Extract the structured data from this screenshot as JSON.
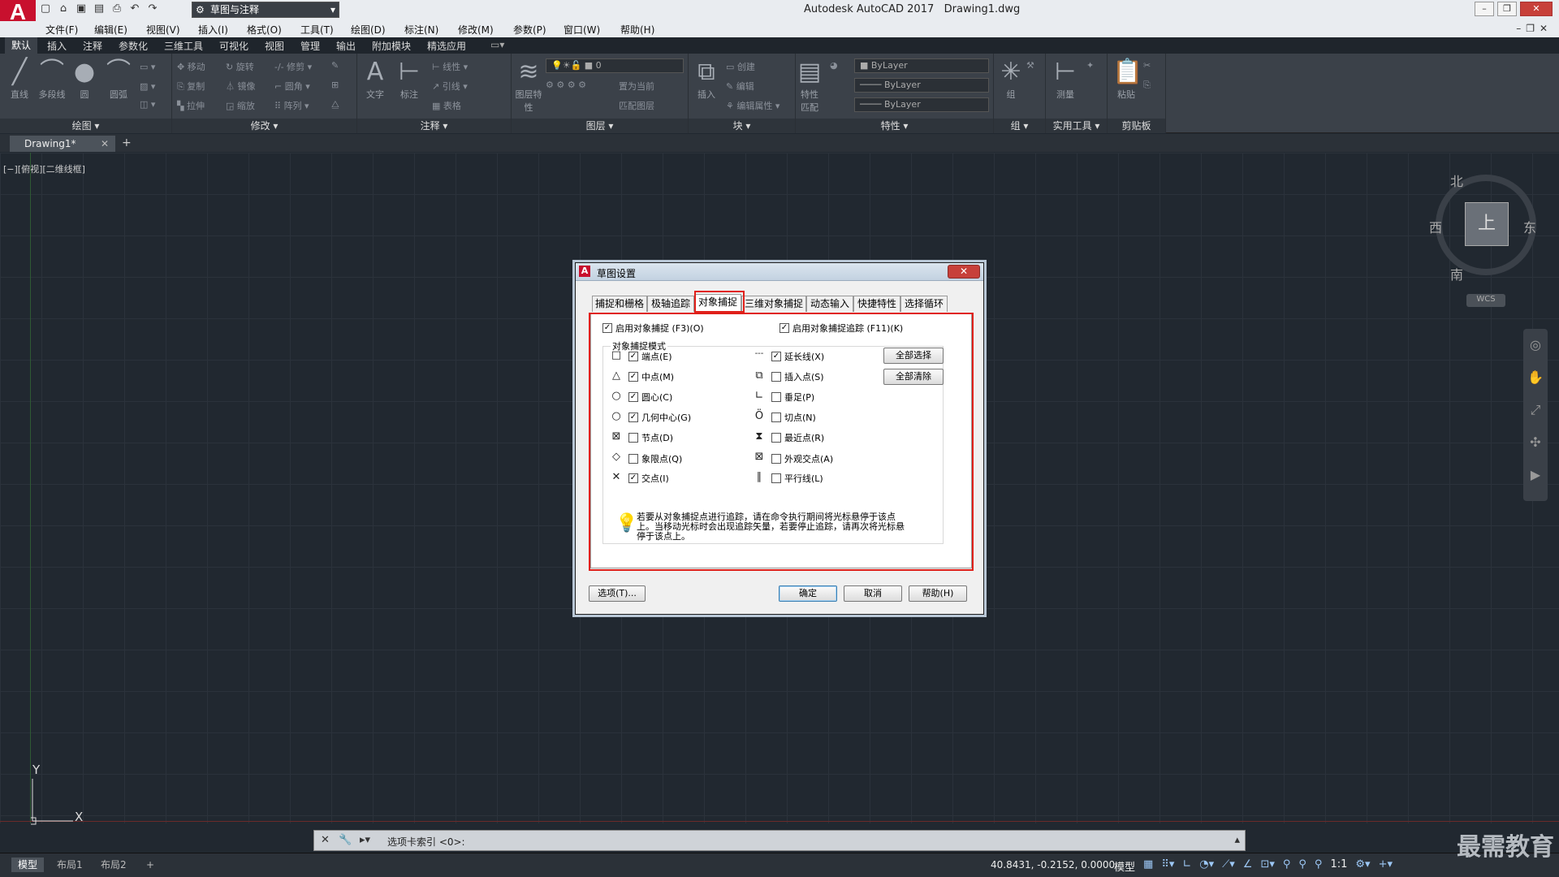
{
  "app": {
    "logo": "A",
    "title": "Autodesk AutoCAD 2017",
    "document": "Drawing1.dwg"
  },
  "workspace": {
    "label": "草图与注释"
  },
  "menu": [
    "文件(F)",
    "编辑(E)",
    "视图(V)",
    "插入(I)",
    "格式(O)",
    "工具(T)",
    "绘图(D)",
    "标注(N)",
    "修改(M)",
    "参数(P)",
    "窗口(W)",
    "帮助(H)"
  ],
  "ribbon_tabs": [
    "默认",
    "插入",
    "注释",
    "参数化",
    "三维工具",
    "可视化",
    "视图",
    "管理",
    "输出",
    "附加模块",
    "精选应用"
  ],
  "ribbon": {
    "draw": {
      "title": "绘图",
      "line": "直线",
      "polyline": "多段线",
      "circle": "圆",
      "arc": "圆弧"
    },
    "modify": {
      "title": "修改",
      "move": "移动",
      "rotate": "旋转",
      "trim": "修剪",
      "copy": "复制",
      "mirror": "镜像",
      "fillet": "圆角",
      "stretch": "拉伸",
      "scale": "缩放",
      "array": "阵列"
    },
    "annotation": {
      "title": "注释",
      "text": "文字",
      "dimension": "标注",
      "linear": "线性",
      "leader": "引线",
      "table": "表格"
    },
    "layers": {
      "title": "图层",
      "layer_props": "图层特性",
      "layer_value": "0",
      "match": "置为当前",
      "match_layer": "匹配图层"
    },
    "block": {
      "title": "块",
      "insert": "插入",
      "create": "创建",
      "edit": "编辑",
      "edit_attr": "编辑属性"
    },
    "properties": {
      "title": "特性",
      "match": "特性匹配",
      "bylayer1": "ByLayer",
      "bylayer2": "ByLayer",
      "bylayer3": "ByLayer"
    },
    "group": {
      "title": "组",
      "group": "组"
    },
    "utilities": {
      "title": "实用工具",
      "measure": "测量"
    },
    "clipboard": {
      "title": "剪贴板",
      "paste": "粘贴"
    }
  },
  "doc_tab": {
    "label": "Drawing1*",
    "close": "✕",
    "add": "+"
  },
  "viewport_label": "[−][俯视][二维线框]",
  "viewcube": {
    "top": "上",
    "north": "北",
    "south": "南",
    "west": "西",
    "east": "东",
    "wcs": "WCS"
  },
  "ucs": {
    "y": "Y",
    "x": "X"
  },
  "dialog": {
    "title": "草图设置",
    "close": "✕",
    "tabs": [
      "捕捉和栅格",
      "极轴追踪",
      "对象捕捉",
      "三维对象捕捉",
      "动态输入",
      "快捷特性",
      "选择循环"
    ],
    "active_tab": "对象捕捉",
    "enable_osnap": {
      "label": "启用对象捕捉 (F3)(O)",
      "checked": true
    },
    "enable_tracking": {
      "label": "启用对象捕捉追踪 (F11)(K)",
      "checked": true
    },
    "group_title": "对象捕捉模式",
    "modes_left": [
      {
        "symbol": "□",
        "label": "端点(E)",
        "checked": true
      },
      {
        "symbol": "△",
        "label": "中点(M)",
        "checked": true
      },
      {
        "symbol": "○",
        "label": "圆心(C)",
        "checked": true
      },
      {
        "symbol": "○",
        "label": "几何中心(G)",
        "checked": true
      },
      {
        "symbol": "⊠",
        "label": "节点(D)",
        "checked": false
      },
      {
        "symbol": "◇",
        "label": "象限点(Q)",
        "checked": false
      },
      {
        "symbol": "✕",
        "label": "交点(I)",
        "checked": true
      }
    ],
    "modes_right": [
      {
        "symbol": "---",
        "label": "延长线(X)",
        "checked": true
      },
      {
        "symbol": "⧉",
        "label": "插入点(S)",
        "checked": false
      },
      {
        "symbol": "∟",
        "label": "垂足(P)",
        "checked": false
      },
      {
        "symbol": "Ö",
        "label": "切点(N)",
        "checked": false
      },
      {
        "symbol": "⧗",
        "label": "最近点(R)",
        "checked": false
      },
      {
        "symbol": "⊠",
        "label": "外观交点(A)",
        "checked": false
      },
      {
        "symbol": "∥",
        "label": "平行线(L)",
        "checked": false
      }
    ],
    "select_all": "全部选择",
    "clear_all": "全部清除",
    "hint": "若要从对象捕捉点进行追踪，请在命令执行期间将光标悬停于该点上。当移动光标时会出现追踪矢量，若要停止追踪，请再次将光标悬停于该点上。",
    "options_btn": "选项(T)...",
    "ok_btn": "确定",
    "cancel_btn": "取消",
    "help_btn": "帮助(H)"
  },
  "command_line": {
    "text": "选项卡索引 <0>:"
  },
  "status": {
    "layout_tabs": [
      "模型",
      "布局1",
      "布局2"
    ],
    "add": "+",
    "coords": "40.8431, -0.2152, 0.0000",
    "model": "模型",
    "scale": "1:1"
  },
  "watermark": "最需教育",
  "colors": {
    "accent": "#c8102e",
    "highlight": "#e0201a",
    "canvas": "#212830"
  }
}
